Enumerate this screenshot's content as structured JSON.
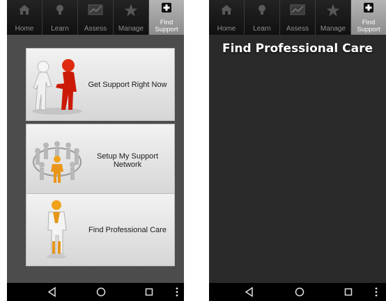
{
  "tabs": [
    {
      "label": "Home",
      "icon": "home-icon"
    },
    {
      "label": "Learn",
      "icon": "lightbulb-icon"
    },
    {
      "label": "Assess",
      "icon": "chart-icon"
    },
    {
      "label": "Manage",
      "icon": "star-icon"
    },
    {
      "label_line1": "Find",
      "label_line2": "Support",
      "icon": "plus-icon",
      "active": true
    }
  ],
  "home_screen": {
    "menu": [
      {
        "label": "Get Support Right Now",
        "icon": "handshake-figures-icon"
      },
      {
        "label": "Setup My Support Network",
        "icon": "support-circle-icon"
      },
      {
        "label": "Find Professional Care",
        "icon": "doctor-figure-icon"
      }
    ]
  },
  "professional_screen": {
    "title": "Find Professional Care"
  },
  "navbar": {
    "back": "back-triangle-icon",
    "home": "home-circle-icon",
    "recents": "recents-square-icon",
    "menu": "overflow-menu-icon"
  },
  "colors": {
    "active_tab": "#9f9f9f",
    "card_bg": "#e6e6e6",
    "accent_red": "#d01b0b",
    "accent_orange": "#f0a31a"
  }
}
